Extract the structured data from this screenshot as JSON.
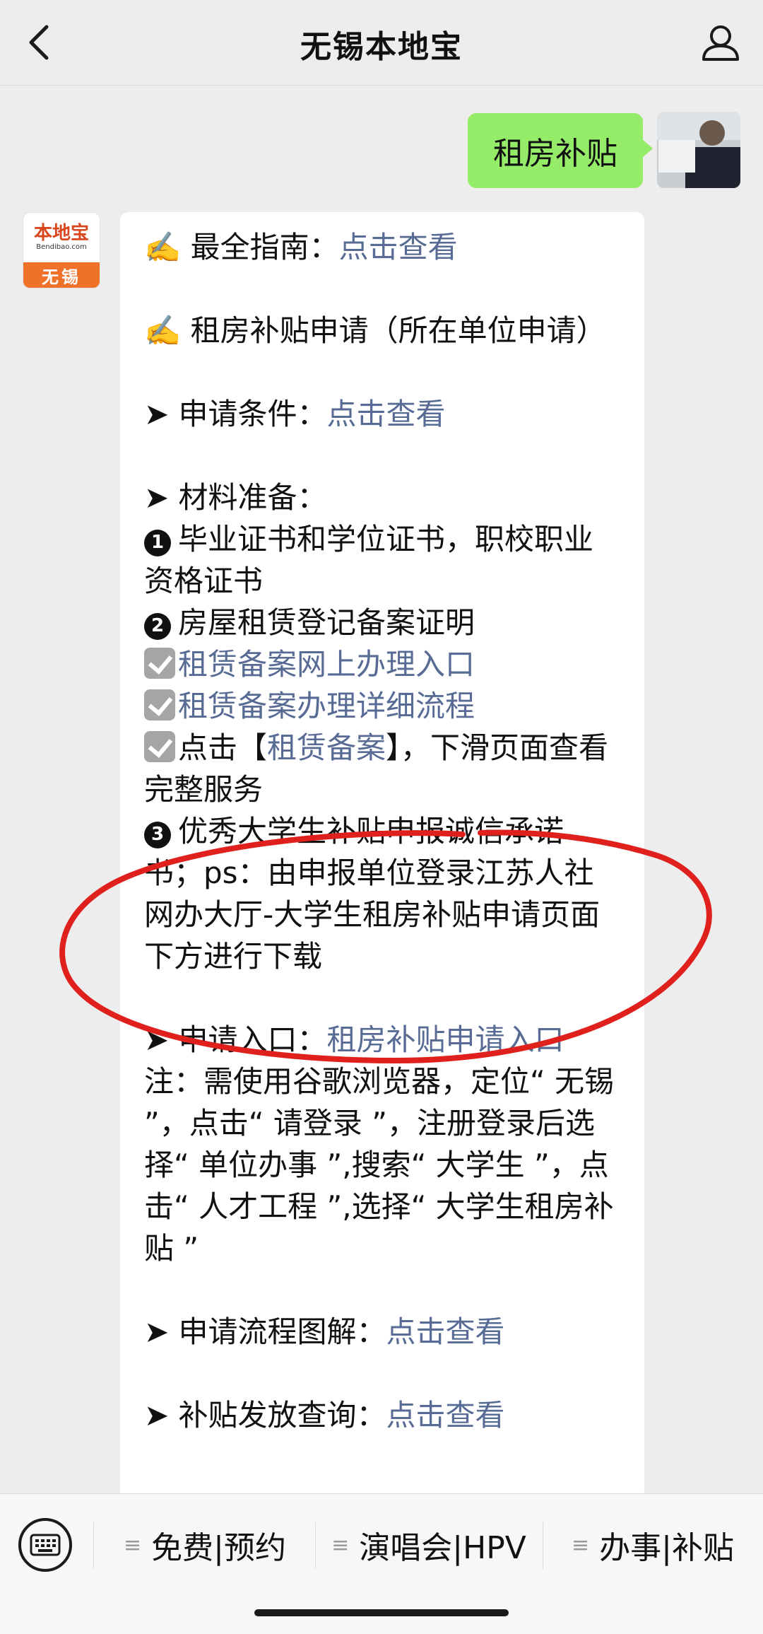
{
  "header": {
    "title": "无锡本地宝",
    "back_icon": "chevron-left-icon",
    "profile_icon": "person-icon"
  },
  "outgoing": {
    "text": "租房补贴"
  },
  "bot": {
    "avatar_brand": "本地宝",
    "avatar_domain": "Bendibao.com",
    "avatar_city": "无锡"
  },
  "message": {
    "guide_prefix": "✍️ 最全指南：",
    "guide_link": "点击查看",
    "apply_heading": "✍️ 租房补贴申请（所在单位申请）",
    "conditions_prefix": "➤ 申请条件：",
    "conditions_link": "点击查看",
    "materials_heading": "➤ 材料准备：",
    "item1": "毕业证书和学位证书，职校职业资格证书",
    "item2": "房屋租赁登记备案证明",
    "link_online": "租赁备案网上办理入口",
    "link_flow": "租赁备案办理详细流程",
    "click_prefix": "点击【",
    "click_link": "租赁备案",
    "click_suffix": "】，下滑页面查看完整服务",
    "item3": "优秀大学生补贴申报诚信承诺书；ps：由申报单位登录江苏人社网办大厅-大学生租房补贴申请页面下方进行下载",
    "entry_prefix": "➤ 申请入口：",
    "entry_link": "租房补贴申请入口",
    "note": "注：需使用谷歌浏览器，定位“ 无锡 ”，点击“ 请登录 ”，注册登录后选择“ 单位办事 ”,搜索“ 大学生 ”，点击“ 人才工程 ”,选择“ 大学生租房补贴 ”",
    "process_prefix": "➤ 申请流程图解：",
    "process_link": "点击查看",
    "query_prefix": "➤ 补贴发放查询：",
    "query_link": "点击查看",
    "num1": "1",
    "num2": "2",
    "num3": "3"
  },
  "bottom_menu": {
    "keyboard_icon": "keyboard-icon",
    "menu_icon": "list-icon",
    "items": [
      "免费|预约",
      "演唱会|HPV",
      "办事|补贴"
    ]
  },
  "colors": {
    "link": "#576b95",
    "outgoing_bubble": "#95ec69",
    "annotation_red": "#e0201c"
  }
}
